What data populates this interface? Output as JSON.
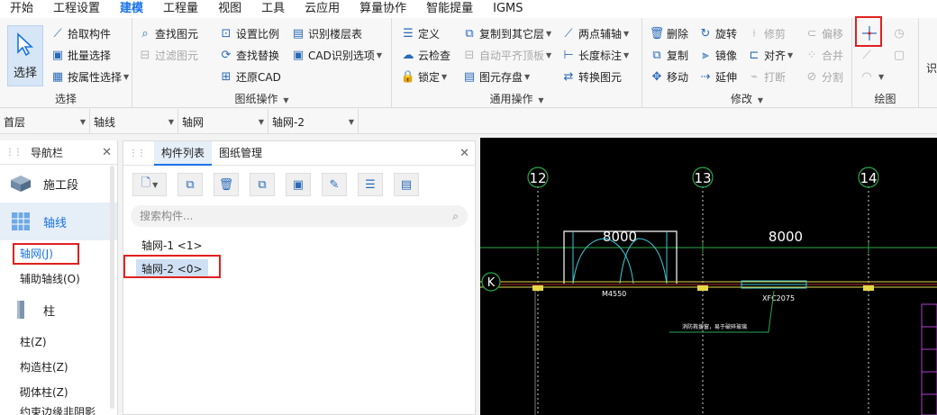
{
  "menu": [
    "开始",
    "工程设置",
    "建模",
    "工程量",
    "视图",
    "工具",
    "云应用",
    "算量协作",
    "智能提量",
    "IGMS"
  ],
  "menu_active": "建模",
  "ribbon": {
    "select": {
      "label": "选择",
      "pick": "拾取构件",
      "batch": "批量选择",
      "by_attr": "按属性选择",
      "group": "选择"
    },
    "drawing": {
      "find": "查找图元",
      "filter": "过滤图元",
      "set_scale": "设置比例",
      "find_replace": "查找替换",
      "restore_cad": "还原CAD",
      "identify_floor": "识别楼层表",
      "cad_options": "CAD识别选项",
      "group": "图纸操作"
    },
    "common": {
      "define": "定义",
      "cloud_check": "云检查",
      "lock": "锁定",
      "copy_to_floor": "复制到其它层",
      "auto_align": "自动平齐顶板",
      "save_elem": "图元存盘",
      "two_point_axis": "两点辅轴",
      "length_dim": "长度标注",
      "convert_elem": "转换图元",
      "group": "通用操作"
    },
    "modify": {
      "delete": "删除",
      "rotate": "旋转",
      "trim": "修剪",
      "offset": "偏移",
      "copy": "复制",
      "mirror": "镜像",
      "align": "对齐",
      "merge": "合并",
      "move": "移动",
      "extend": "延伸",
      "break": "打断",
      "split": "分割",
      "group": "修改"
    },
    "draw": {
      "group": "绘图"
    },
    "identify": {
      "label": "识"
    }
  },
  "toolbar2": {
    "floor": "首层",
    "type": "轴线",
    "sub": "轴网",
    "item": "轴网-2"
  },
  "nav": {
    "title": "导航栏",
    "cats": {
      "construction": "施工段",
      "axis": "轴线",
      "column": "柱"
    },
    "subs": {
      "axis_grid": "轴网(J)",
      "aux_axis": "辅助轴线(O)",
      "column_z": "柱(Z)",
      "struct_column": "构造柱(Z)",
      "masonry_column": "砌体柱(Z)",
      "partial": "约束边缘非阴影"
    }
  },
  "complist": {
    "tab_list": "构件列表",
    "tab_drawing": "图纸管理",
    "search_placeholder": "搜索构件...",
    "items": [
      "轴网-1 <1>",
      "轴网-2 <0>"
    ]
  },
  "cad": {
    "axes": [
      "12",
      "13",
      "14"
    ],
    "row_label": "K",
    "dims": [
      "8000",
      "8000"
    ],
    "door_label": "M4550",
    "window_label": "XFC2075",
    "note": "消防救援窗，易于破碎玻璃"
  },
  "colors": {
    "accent": "#1a73e8",
    "highlight": "#e02020",
    "canvas": "#000000"
  }
}
